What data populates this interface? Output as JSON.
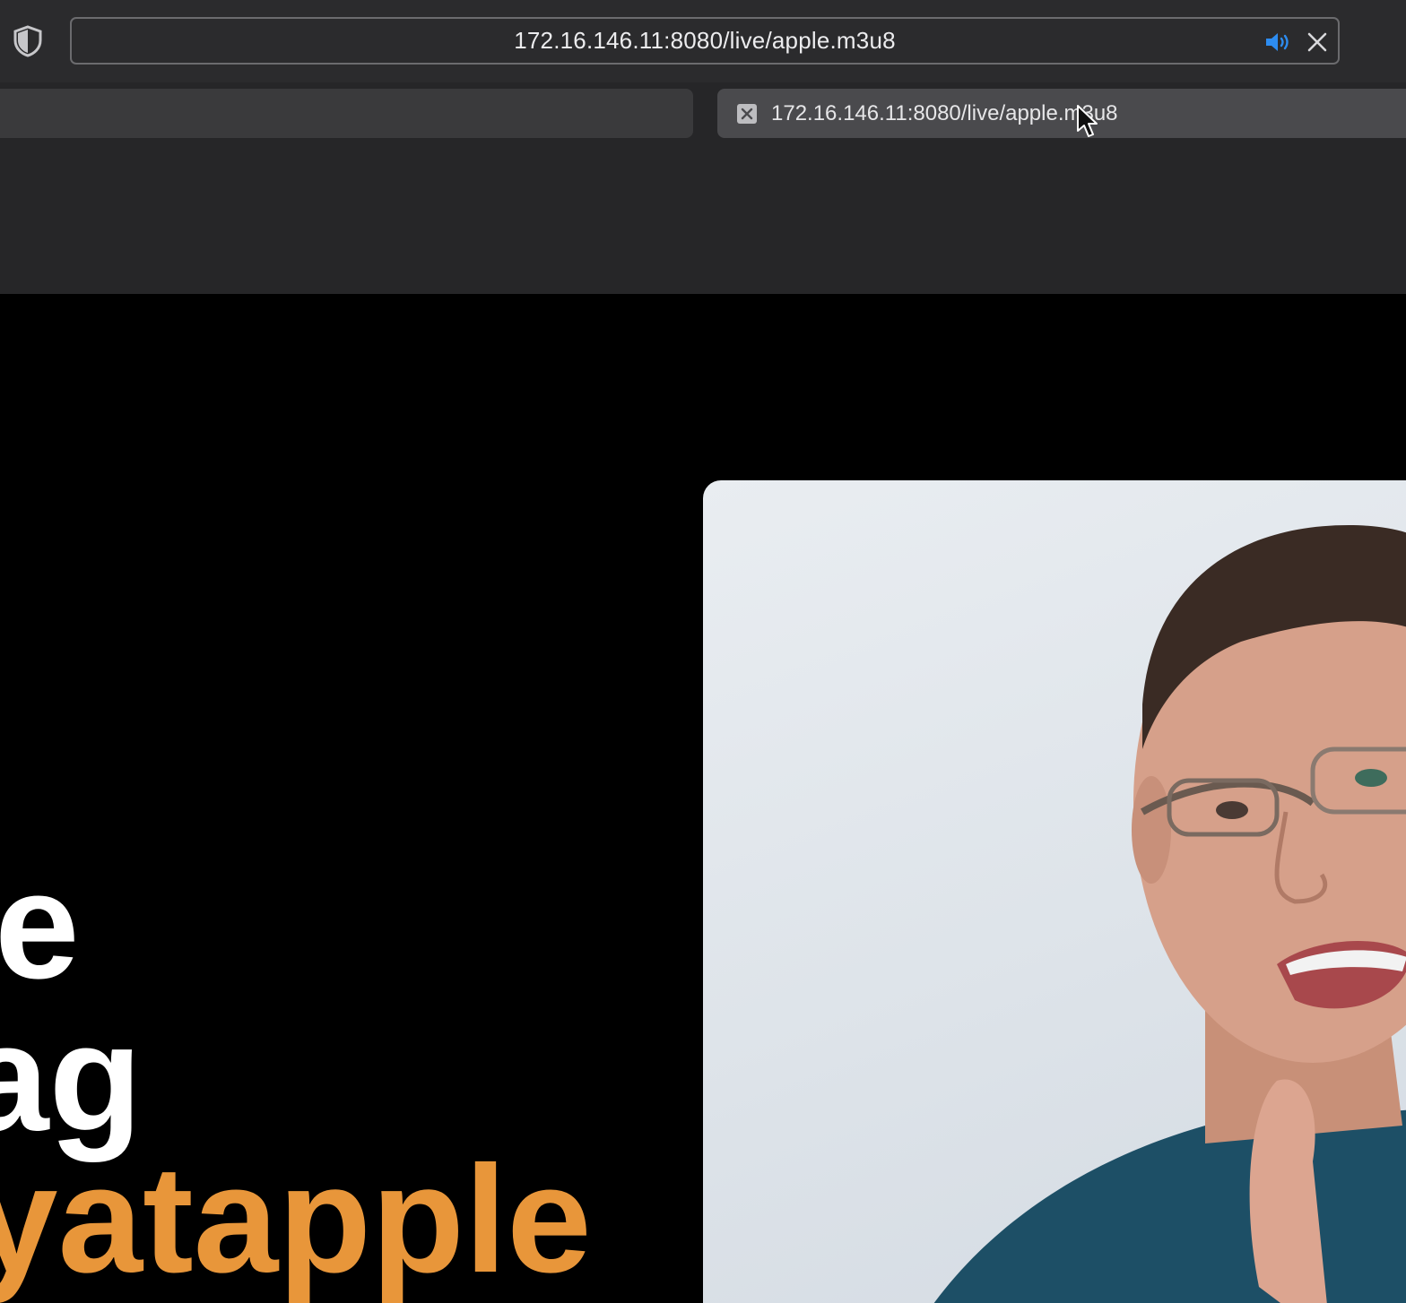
{
  "browser": {
    "address_url": "172.16.146.11:8080/live/apple.m3u8",
    "icons": {
      "privacy": "shield-icon",
      "audio": "speaker-icon",
      "close": "close-icon",
      "audio_color": "#2d8cf0"
    }
  },
  "tabs": [
    {
      "title": ""
    },
    {
      "title": "172.16.146.11:8080/live/apple.m3u8"
    }
  ],
  "video": {
    "headline_lines": [
      "e",
      "ag",
      "yatapple"
    ],
    "headline_colors": [
      "#ffffff",
      "#ffffff",
      "#e8963a"
    ]
  }
}
